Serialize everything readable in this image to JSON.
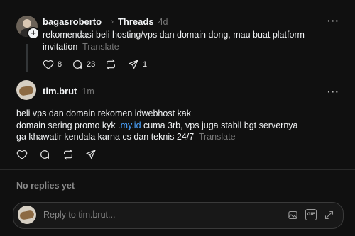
{
  "original_post": {
    "username": "bagasroberto_",
    "channel": "Threads",
    "time": "4d",
    "text": "rekomendasi beli hosting/vps dan domain dong, mau buat platform",
    "text_line2": "invitation",
    "translate": "Translate",
    "more": "···",
    "actions": {
      "likes": "8",
      "comments": "23",
      "reposts": "",
      "shares": "1"
    }
  },
  "reply": {
    "username": "tim.brut",
    "time": "1m",
    "more": "···",
    "line1": "beli vps dan domain rekomen idwebhost kak",
    "line2_prefix": "domain sering promo kyk .",
    "line2_link": "my.id",
    "line2_suffix": " cuma 3rb, vps juga stabil bgt servernya",
    "line3": "ga khawatir kendala karna cs dan teknis 24/7",
    "translate": "Translate"
  },
  "no_replies": "No replies yet",
  "composer": {
    "placeholder": "Reply to tim.brut...",
    "gif_label": "GIF"
  },
  "colors": {
    "background": "#101010",
    "text": "#f3f5f7",
    "muted": "#777777",
    "link": "#4ba3ff"
  }
}
